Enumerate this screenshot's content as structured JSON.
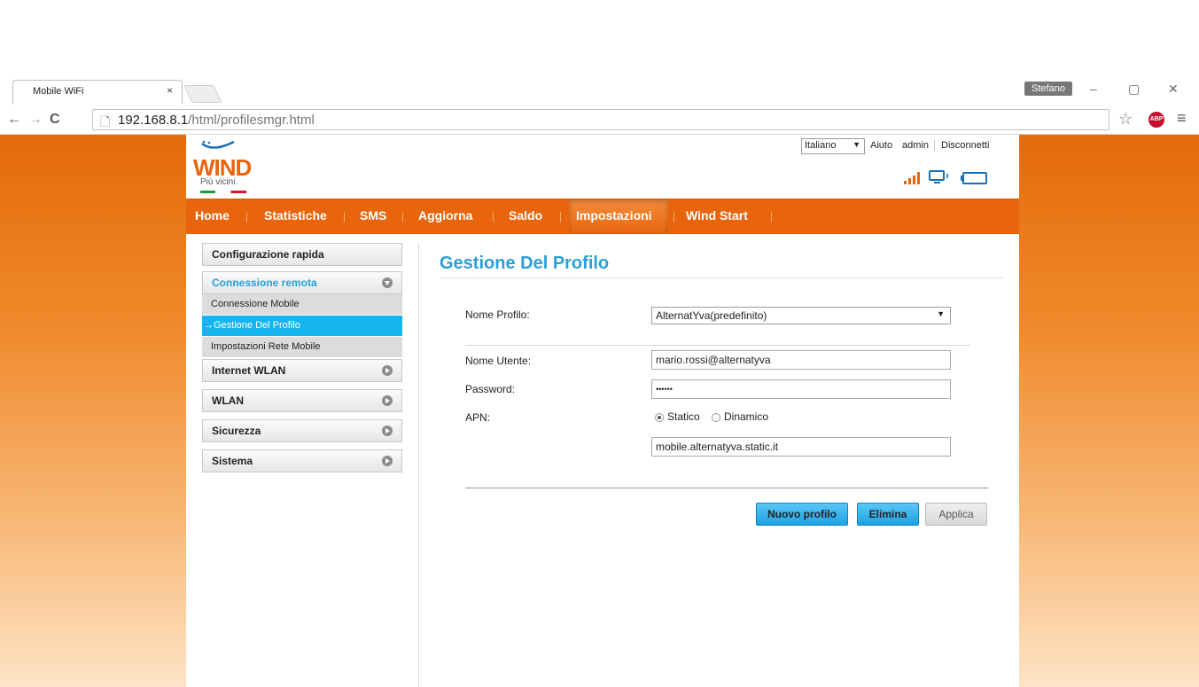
{
  "browser": {
    "tab_title": "Mobile WiFi",
    "tab_close": "×",
    "profile_name": "Stefano",
    "url_host": "192.168.8.1",
    "url_path": "/html/profilesmgr.html"
  },
  "header": {
    "logo_text": "WIND",
    "tagline": "Più vicini.",
    "language": "Italiano",
    "help": "Aiuto",
    "user": "admin",
    "logout": "Disconnetti"
  },
  "nav": {
    "items": [
      "Home",
      "Statistiche",
      "SMS",
      "Aggiorna",
      "Saldo",
      "Impostazioni",
      "Wind Start"
    ],
    "active": "Impostazioni"
  },
  "sidebar": {
    "quick_setup": "Configurazione rapida",
    "remote_connection": "Connessione remota",
    "sub_items": [
      "Connessione Mobile",
      "→Gestione Del Profilo",
      "Impostazioni Rete Mobile"
    ],
    "internet_wlan": "Internet WLAN",
    "wlan": "WLAN",
    "security": "Sicurezza",
    "system": "Sistema"
  },
  "main": {
    "title": "Gestione Del Profilo",
    "profile_label": "Nome Profilo:",
    "profile_value": "AlternatYva(predefinito)",
    "username_label": "Nome Utente:",
    "username_value": "mario.rossi@alternatyva",
    "password_label": "Password:",
    "password_value": "••••••",
    "apn_label": "APN:",
    "apn_static": "Statico",
    "apn_dynamic": "Dinamico",
    "apn_selected": "Statico",
    "apn_value": "mobile.alternatyva.static.it",
    "btn_new": "Nuovo profilo",
    "btn_delete": "Elimina",
    "btn_apply": "Applica"
  },
  "colors": {
    "brand_orange": "#e8650e",
    "accent_blue": "#15b6ef",
    "title_blue": "#2a9fd6"
  }
}
